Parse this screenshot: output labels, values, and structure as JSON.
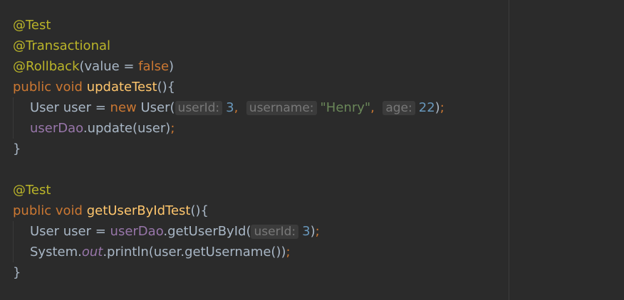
{
  "code_lines": [
    {
      "indent": false,
      "tokens": [
        {
          "text": "@Test",
          "kind": "annotation"
        }
      ]
    },
    {
      "indent": false,
      "tokens": [
        {
          "text": "@Transactional",
          "kind": "annotation"
        }
      ]
    },
    {
      "indent": false,
      "tokens": [
        {
          "text": "@Rollback",
          "kind": "annotation"
        },
        {
          "text": "(value = ",
          "kind": "plain"
        },
        {
          "text": "false",
          "kind": "keyword"
        },
        {
          "text": ")",
          "kind": "plain"
        }
      ]
    },
    {
      "indent": false,
      "tokens": [
        {
          "text": "public void ",
          "kind": "keyword"
        },
        {
          "text": "updateTest",
          "kind": "method"
        },
        {
          "text": "(){",
          "kind": "plain"
        }
      ]
    },
    {
      "indent": true,
      "tokens": [
        {
          "text": "User user = ",
          "kind": "plain"
        },
        {
          "text": "new ",
          "kind": "keyword"
        },
        {
          "text": "User(",
          "kind": "plain"
        },
        {
          "text": "userId:",
          "kind": "hint"
        },
        {
          "text": "3",
          "kind": "number"
        },
        {
          "text": ",  ",
          "kind": "keyword"
        },
        {
          "text": "username:",
          "kind": "hint"
        },
        {
          "text": "\"Henry\"",
          "kind": "string"
        },
        {
          "text": ",  ",
          "kind": "keyword"
        },
        {
          "text": "age:",
          "kind": "hint"
        },
        {
          "text": "22",
          "kind": "number"
        },
        {
          "text": ")",
          "kind": "plain"
        },
        {
          "text": ";",
          "kind": "keyword"
        }
      ]
    },
    {
      "indent": true,
      "tokens": [
        {
          "text": "userDao",
          "kind": "field"
        },
        {
          "text": ".update(user)",
          "kind": "plain"
        },
        {
          "text": ";",
          "kind": "keyword"
        }
      ]
    },
    {
      "indent": false,
      "tokens": [
        {
          "text": "}",
          "kind": "plain"
        }
      ]
    },
    {
      "indent": false,
      "tokens": []
    },
    {
      "indent": false,
      "tokens": [
        {
          "text": "@Test",
          "kind": "annotation"
        }
      ]
    },
    {
      "indent": false,
      "tokens": [
        {
          "text": "public void ",
          "kind": "keyword"
        },
        {
          "text": "getUserByIdTest",
          "kind": "method"
        },
        {
          "text": "(){",
          "kind": "plain"
        }
      ]
    },
    {
      "indent": true,
      "tokens": [
        {
          "text": "User user = ",
          "kind": "plain"
        },
        {
          "text": "userDao",
          "kind": "field"
        },
        {
          "text": ".getUserById(",
          "kind": "plain"
        },
        {
          "text": "userId:",
          "kind": "hint"
        },
        {
          "text": "3",
          "kind": "number"
        },
        {
          "text": ")",
          "kind": "plain"
        },
        {
          "text": ";",
          "kind": "keyword"
        }
      ]
    },
    {
      "indent": true,
      "tokens": [
        {
          "text": "System.",
          "kind": "plain"
        },
        {
          "text": "out",
          "kind": "static-field"
        },
        {
          "text": ".println(user.getUsername())",
          "kind": "plain"
        },
        {
          "text": ";",
          "kind": "keyword"
        }
      ]
    },
    {
      "indent": false,
      "tokens": [
        {
          "text": "}",
          "kind": "plain"
        }
      ]
    }
  ]
}
